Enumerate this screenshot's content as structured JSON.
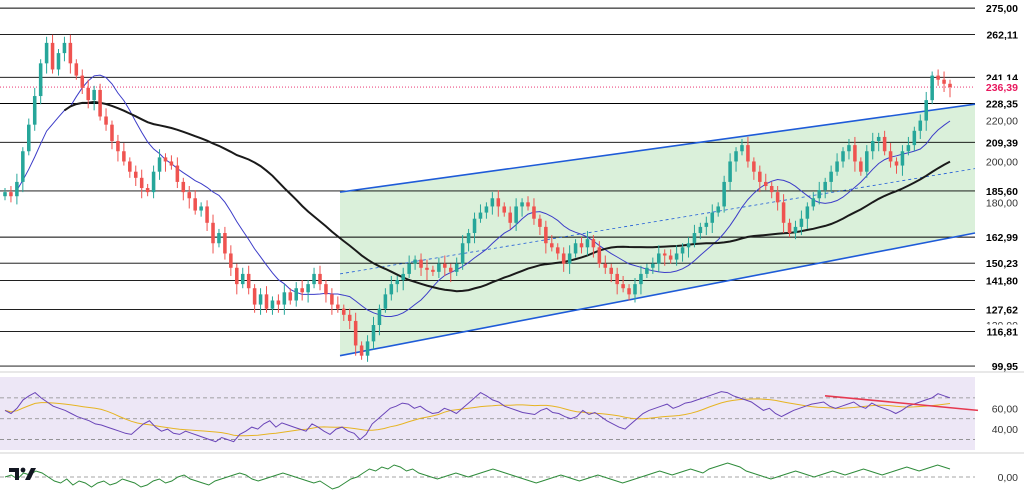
{
  "chart_data": [
    {
      "type": "candlestick",
      "title": "",
      "y_ticks": [
        "275,00",
        "262,11",
        "241,14",
        "236,39",
        "228,35",
        "220,00",
        "209,39",
        "200,00",
        "185,60",
        "180,00",
        "162,99",
        "150,23",
        "141,80",
        "127,62",
        "120,00",
        "116,81",
        "99,95"
      ],
      "horizontal_levels": [
        275.0,
        262.11,
        241.14,
        228.35,
        209.39,
        185.6,
        162.99,
        150.23,
        141.8,
        127.62,
        116.81,
        99.95
      ],
      "current_price": 236.39,
      "ylim": [
        98,
        278
      ],
      "candle_count": 160,
      "candle_closes": [
        185,
        183,
        190,
        205,
        218,
        232,
        248,
        258,
        245,
        253,
        258,
        248,
        242,
        236,
        230,
        235,
        222,
        218,
        210,
        205,
        200,
        195,
        192,
        187,
        185,
        195,
        202,
        200,
        198,
        190,
        185,
        182,
        176,
        178,
        170,
        160,
        165,
        155,
        148,
        140,
        145,
        138,
        130,
        135,
        128,
        132,
        130,
        136,
        132,
        138,
        136,
        140,
        145,
        140,
        135,
        130,
        128,
        125,
        122,
        110,
        105,
        112,
        120,
        128,
        135,
        140,
        142,
        145,
        150,
        152,
        148,
        147,
        146,
        150,
        148,
        146,
        150,
        160,
        165,
        172,
        175,
        178,
        182,
        178,
        175,
        170,
        178,
        180,
        178,
        172,
        168,
        160,
        158,
        155,
        150,
        155,
        160,
        158,
        162,
        158,
        150,
        148,
        145,
        140,
        138,
        135,
        140,
        145,
        148,
        150,
        155,
        154,
        152,
        155,
        158,
        160,
        165,
        168,
        170,
        175,
        178,
        190,
        200,
        205,
        208,
        200,
        195,
        190,
        188,
        185,
        180,
        170,
        165,
        168,
        172,
        178,
        182,
        186,
        190,
        195,
        200,
        205,
        208,
        200,
        195,
        205,
        210,
        212,
        205,
        200,
        198,
        205,
        208,
        215,
        220,
        230,
        242,
        240,
        238,
        236.39
      ],
      "channel": {
        "upper_start": 185.0,
        "upper_end": 228.0,
        "lower_start": 105.0,
        "lower_end": 165.0
      },
      "moving_averages": [
        {
          "color": "#1a1a1a",
          "description": "long moving average"
        },
        {
          "color": "#3c3cc8",
          "description": "short moving average"
        }
      ],
      "colors": {
        "up": "#26a69a",
        "down": "#ef5350",
        "channel_fill": "#d4edd4",
        "channel_line": "#1e5bd8",
        "current_price": "#e8175d"
      }
    },
    {
      "type": "line",
      "title": "",
      "y_ticks": [
        "60,00",
        "40,00"
      ],
      "ylim": [
        20,
        90
      ],
      "reference_lines": [
        70,
        50,
        30
      ],
      "values": [
        58,
        55,
        60,
        68,
        72,
        75,
        70,
        66,
        62,
        60,
        58,
        55,
        52,
        50,
        48,
        45,
        44,
        42,
        40,
        38,
        36,
        35,
        40,
        45,
        48,
        42,
        38,
        40,
        36,
        35,
        38,
        36,
        34,
        32,
        30,
        28,
        32,
        30,
        28,
        35,
        38,
        42,
        40,
        45,
        48,
        42,
        46,
        44,
        42,
        40,
        38,
        45,
        42,
        38,
        35,
        40,
        42,
        38,
        36,
        30,
        35,
        45,
        50,
        55,
        60,
        62,
        65,
        64,
        60,
        62,
        58,
        55,
        56,
        60,
        58,
        55,
        60,
        65,
        70,
        75,
        72,
        68,
        66,
        62,
        60,
        58,
        56,
        55,
        54,
        58,
        60,
        56,
        55,
        52,
        50,
        52,
        58,
        54,
        56,
        52,
        48,
        45,
        42,
        40,
        45,
        50,
        55,
        58,
        60,
        62,
        64,
        60,
        62,
        65,
        66,
        68,
        70,
        72,
        74,
        76,
        75,
        72,
        70,
        68,
        66,
        62,
        58,
        60,
        55,
        52,
        55,
        58,
        60,
        62,
        64,
        65,
        66,
        62,
        60,
        62,
        64,
        66,
        62,
        60,
        65,
        62,
        60,
        58,
        55,
        58,
        62,
        64,
        66,
        68,
        70,
        74,
        72,
        70
      ],
      "signal_color": "#e6b422",
      "line_color": "#6a45b8",
      "divergence_line": {
        "color": "#e53950"
      }
    },
    {
      "type": "line",
      "title": "",
      "y_ticks": [
        "0,00"
      ],
      "values": [
        0,
        1,
        -1,
        2,
        1,
        3,
        2,
        0,
        -2,
        -3,
        -1,
        -4,
        -2,
        -3,
        -5,
        -3,
        -2,
        -4,
        -3,
        -1,
        -2,
        -3,
        -5,
        -4,
        -2,
        -1,
        -3,
        -2,
        0,
        1,
        -1,
        -2,
        -3,
        -4,
        -2,
        -1,
        0,
        1,
        2,
        1,
        -1,
        -2,
        -1,
        0,
        1,
        2,
        1,
        0,
        -1,
        -2,
        -3,
        -2,
        -4,
        -6,
        -5,
        -3,
        -1,
        0,
        2,
        4,
        3,
        5,
        4,
        6,
        5,
        3,
        4,
        2,
        1,
        0,
        -1,
        0,
        1,
        2,
        1,
        0,
        1,
        2,
        3,
        4,
        3,
        2,
        1,
        0,
        -1,
        -2,
        -3,
        -2,
        -1,
        0,
        1,
        0,
        -1,
        -2,
        -1,
        0,
        1,
        0,
        -1,
        -2,
        -3,
        -2,
        -1,
        0,
        1,
        2,
        3,
        2,
        1,
        2,
        3,
        4,
        3,
        2,
        4,
        5,
        6,
        7,
        6,
        5,
        3,
        2,
        1,
        0,
        -1,
        0,
        1,
        2,
        3,
        2,
        1,
        0,
        1,
        2,
        3,
        2,
        1,
        2,
        3,
        4,
        3,
        2,
        1,
        2,
        3,
        4,
        5,
        4,
        3,
        4,
        5,
        6,
        5,
        4
      ],
      "reference_lines": [
        0
      ],
      "line_color": "#2e8b3a"
    }
  ],
  "branding": {
    "logo": "tradingview-logo"
  }
}
